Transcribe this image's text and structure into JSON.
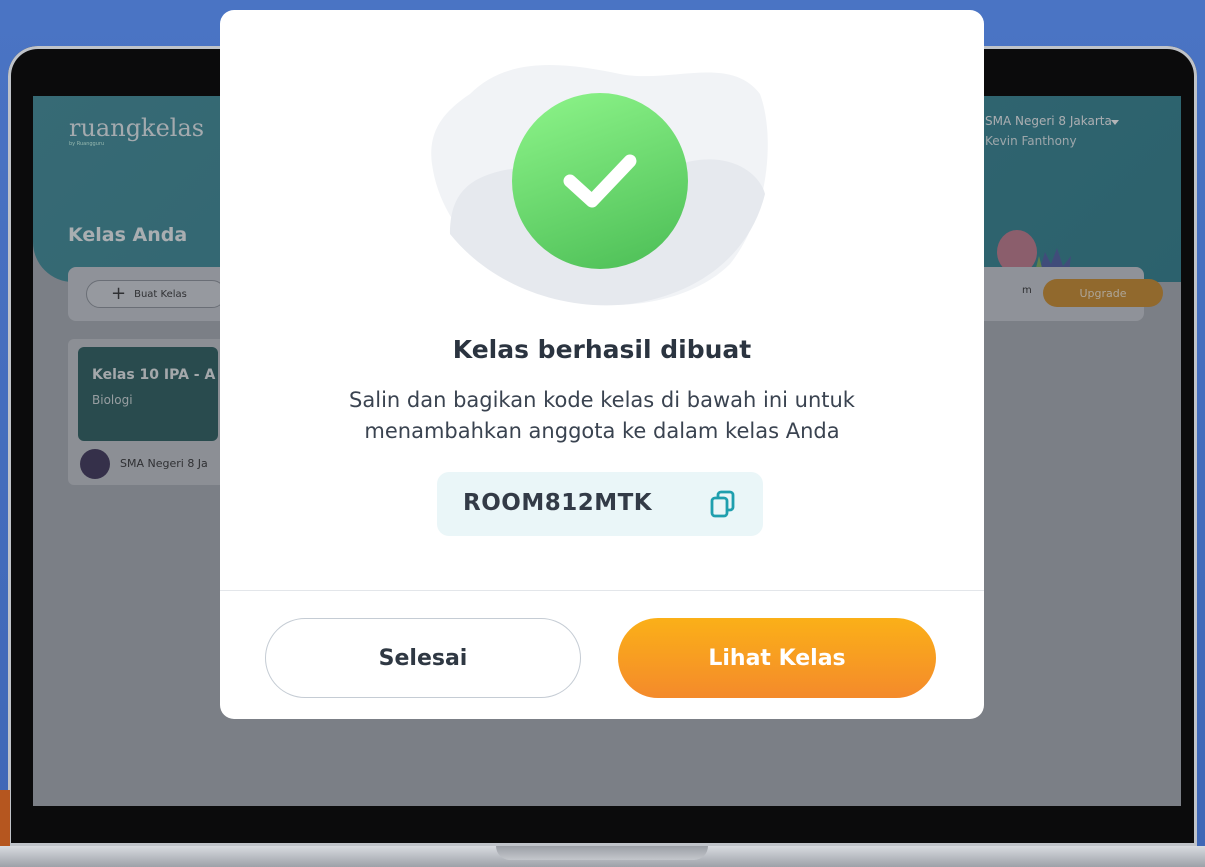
{
  "background_app": {
    "logo": "ruangkelas",
    "logo_sub": "by Ruangguru",
    "user": {
      "school": "SMA Negeri 8 Jakarta",
      "name": "Kevin Fanthony"
    },
    "page_title": "Kelas Anda",
    "toolbar": {
      "create_label": "Buat Kelas",
      "side_text": "m",
      "upgrade_label": "Upgrade"
    },
    "class_card": {
      "name": "Kelas 10 IPA - A",
      "subject": "Biologi",
      "school": "SMA Negeri 8 Ja"
    }
  },
  "modal": {
    "title": "Kelas berhasil dibuat",
    "description": "Salin dan bagikan kode kelas di bawah ini untuk menambahkan anggota ke dalam kelas Anda",
    "class_code": "ROOM812MTK",
    "icons": {
      "success": "check-icon",
      "copy": "copy-icon"
    },
    "buttons": {
      "done": "Selesai",
      "view": "Lihat Kelas"
    }
  },
  "colors": {
    "accent_orange": "#F7982A",
    "success_green": "#5CD065",
    "code_bg": "#EAF6F8",
    "header_teal": "#3A8A96"
  }
}
